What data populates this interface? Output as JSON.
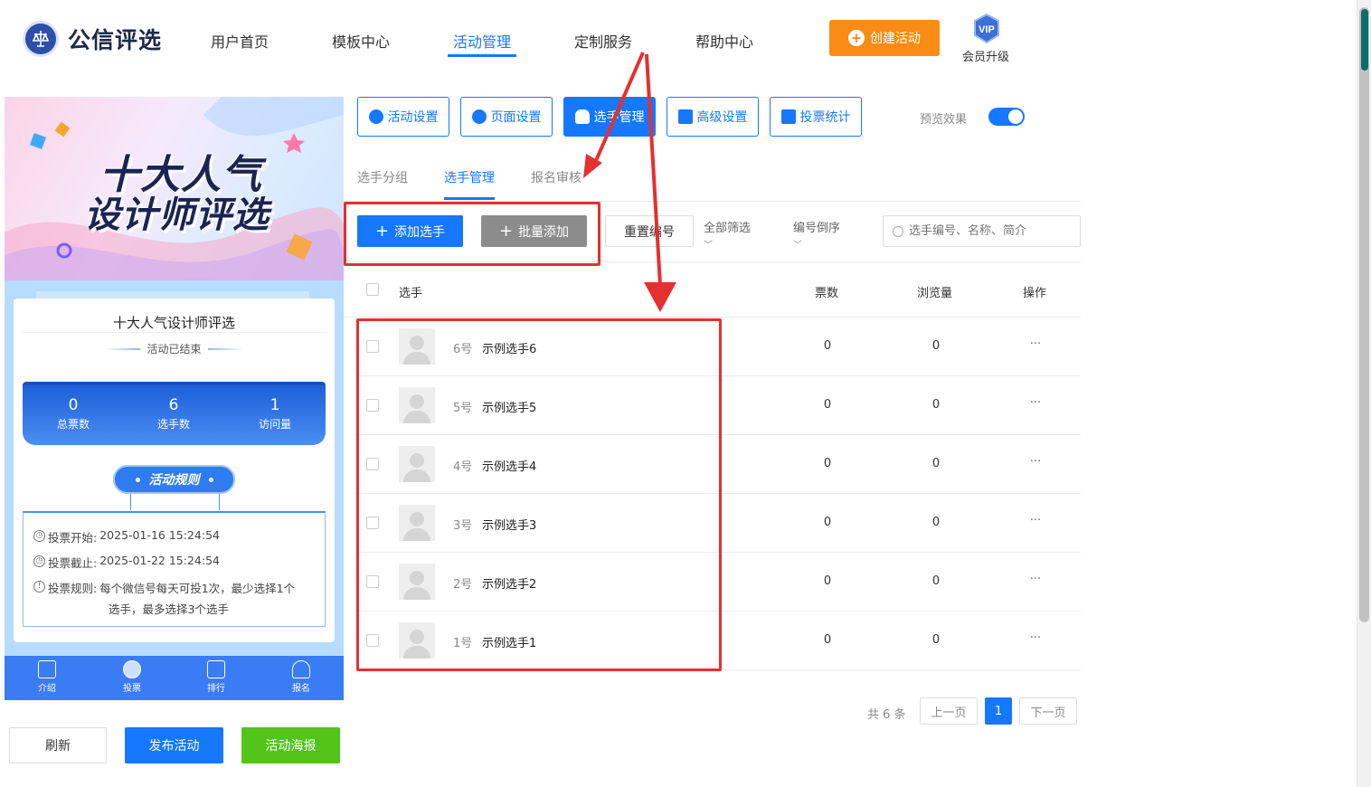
{
  "header": {
    "logo_text": "公信评选",
    "nav": [
      "用户首页",
      "模板中心",
      "活动管理",
      "定制服务",
      "帮助中心"
    ],
    "create_label": "创建活动",
    "vip_badge": "VIP",
    "vip_label": "会员升级"
  },
  "preview": {
    "banner_line1": "十大人气",
    "banner_line2": "设计师评选",
    "title": "十大人气设计师评选",
    "status": "活动已结束",
    "stats": [
      {
        "num": "0",
        "label": "总票数"
      },
      {
        "num": "6",
        "label": "选手数"
      },
      {
        "num": "1",
        "label": "访问量"
      }
    ],
    "rules_title": "活动规则",
    "rules": [
      {
        "label": "投票开始:",
        "value": "2025-01-16 15:24:54"
      },
      {
        "label": "投票截止:",
        "value": "2025-01-22 15:24:54"
      },
      {
        "label": "投票规则:",
        "value": "每个微信号每天可投1次，最少选择1个",
        "value2": "选手，最多选择3个选手"
      }
    ],
    "tabs": [
      "介绍",
      "投票",
      "排行",
      "报名"
    ],
    "btn_refresh": "刷新",
    "btn_publish": "发布活动",
    "btn_poster": "活动海报"
  },
  "toolbar": {
    "buttons": [
      "活动设置",
      "页面设置",
      "选手管理",
      "高级设置",
      "投票统计"
    ],
    "preview_label": "预览效果"
  },
  "subtabs": [
    "选手分组",
    "选手管理",
    "报名审核"
  ],
  "actions": {
    "add": "添加选手",
    "batch": "批量添加",
    "reset": "重置编号",
    "filter1": "全部筛选",
    "filter2": "编号倒序",
    "search_placeholder": "选手编号、名称、简介"
  },
  "table": {
    "headers": [
      "选手",
      "票数",
      "浏览量",
      "操作"
    ],
    "rows": [
      {
        "no": "6号",
        "name": "示例选手6",
        "votes": "0",
        "views": "0"
      },
      {
        "no": "5号",
        "name": "示例选手5",
        "votes": "0",
        "views": "0"
      },
      {
        "no": "4号",
        "name": "示例选手4",
        "votes": "0",
        "views": "0"
      },
      {
        "no": "3号",
        "name": "示例选手3",
        "votes": "0",
        "views": "0"
      },
      {
        "no": "2号",
        "name": "示例选手2",
        "votes": "0",
        "views": "0"
      },
      {
        "no": "1号",
        "name": "示例选手1",
        "votes": "0",
        "views": "0"
      }
    ],
    "more": "···"
  },
  "pagination": {
    "total": "共 6 条",
    "prev": "上一页",
    "current": "1",
    "next": "下一页"
  },
  "colors": {
    "primary": "#1677ff",
    "orange": "#fa8c16",
    "green": "#52c41a",
    "annotation_red": "#e53030"
  }
}
